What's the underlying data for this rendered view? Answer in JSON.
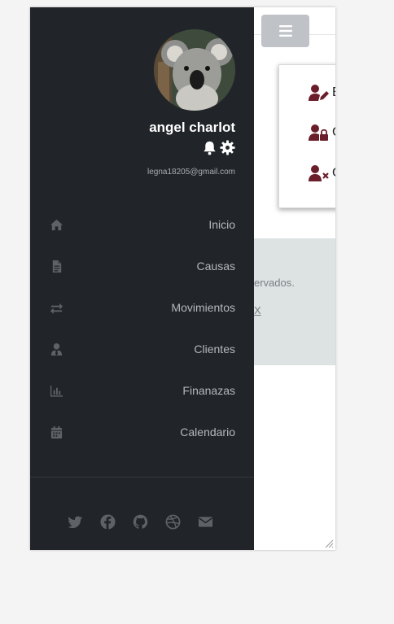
{
  "header": {
    "menu_icon": "hamburger-icon"
  },
  "dropdown": {
    "items": [
      {
        "label": "E",
        "icon": "user-edit-icon"
      },
      {
        "label": "C",
        "icon": "user-lock-icon"
      },
      {
        "label": "C",
        "icon": "user-times-icon"
      }
    ]
  },
  "footer": {
    "line1": "ervados.",
    "line2": "X"
  },
  "sidebar": {
    "user": {
      "name": "angel charlot",
      "email": "legna18205@gmail.com",
      "avatar": "koala-avatar",
      "icons": [
        "bell-icon",
        "gear-icon"
      ]
    },
    "nav": [
      {
        "label": "Inicio",
        "icon": "home-icon"
      },
      {
        "label": "Causas",
        "icon": "document-icon"
      },
      {
        "label": "Movimientos",
        "icon": "exchange-icon"
      },
      {
        "label": "Clientes",
        "icon": "user-tie-icon"
      },
      {
        "label": "Finanazas",
        "icon": "chart-icon"
      },
      {
        "label": "Calendario",
        "icon": "calendar-icon"
      }
    ],
    "social": [
      "twitter-icon",
      "facebook-icon",
      "github-icon",
      "dribbble-icon",
      "envelope-icon"
    ]
  },
  "colors": {
    "sidebar_bg": "#212529",
    "accent_icon": "#6b1e2a",
    "toggle_bg": "#bfc2c6"
  }
}
